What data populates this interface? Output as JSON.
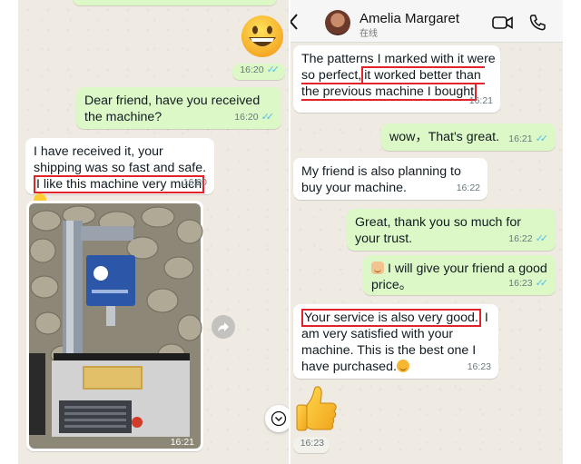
{
  "left_chat": {
    "first_time": "16:20",
    "messages": [
      {
        "text": "Dear friend, have you received the machine?",
        "time": "16:20"
      },
      {
        "text_a": "I have received it, your shipping was so fast and safe.",
        "text_hl": "I like this machine very much",
        "time": "16:20"
      }
    ],
    "photo_time": "16:21"
  },
  "right_chat": {
    "header": {
      "name": "Amelia Margaret",
      "status": "在线"
    },
    "messages": [
      {
        "text_a": "The patterns I marked with it were so perfect,",
        "text_hl": "it worked better than the previous machine I bought",
        "time": "16:21"
      },
      {
        "text": "wow，That's great.",
        "time": "16:21"
      },
      {
        "text": "My friend is also planning to buy your machine.",
        "time": "16:22"
      },
      {
        "text": "Great, thank you so much for your trust.",
        "time": "16:22"
      },
      {
        "text": "I will give your friend a good price。",
        "time": "16:23"
      },
      {
        "text_hl": "Your service is also very good.",
        "text_b": " I am very satisfied with your machine. This is the best one I have purchased.",
        "time": "16:23"
      }
    ],
    "thumbs_time": "16:23"
  },
  "colors": {
    "outgoing": "#dcf8c6",
    "incoming": "#ffffff",
    "highlight": "#e0242a",
    "read_ticks": "#53bdeb"
  },
  "icons": [
    "grinning-emoji-icon",
    "smile-emoji-icon",
    "share-icon",
    "scroll-down-icon",
    "back-icon",
    "video-call-icon",
    "phone-icon",
    "flexed-biceps-emoji-icon",
    "smiling-hearts-emoji-icon",
    "thumbs-up-icon"
  ]
}
